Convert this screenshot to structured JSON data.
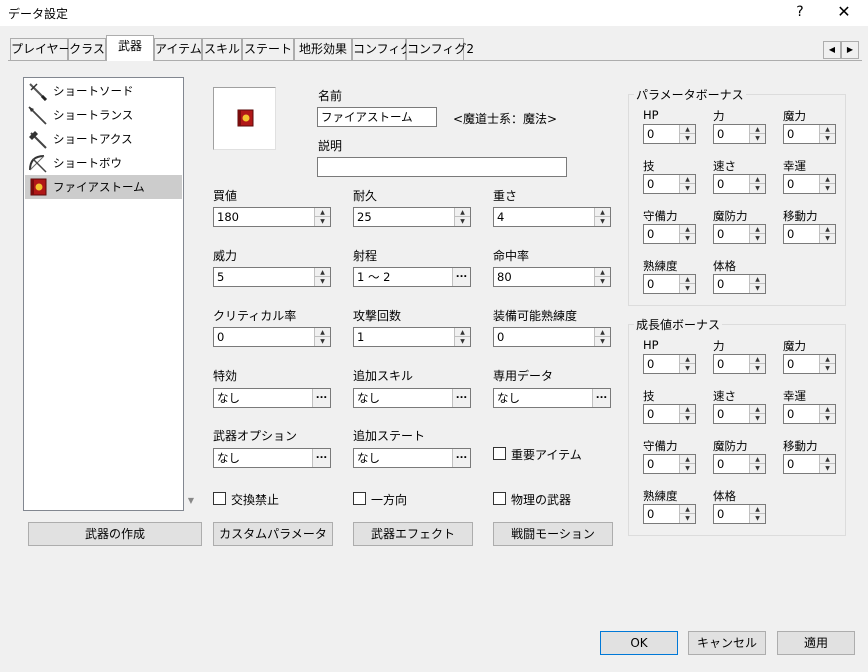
{
  "window": {
    "title": "データ設定",
    "help": "?",
    "close": "✕"
  },
  "tabs": [
    "プレイヤー",
    "クラス",
    "武器",
    "アイテム",
    "スキル",
    "ステート",
    "地形効果",
    "コンフィグ",
    "コンフィグ2"
  ],
  "weapon_list": [
    {
      "name": "ショートソード",
      "icon": "sword-icon"
    },
    {
      "name": "ショートランス",
      "icon": "lance-icon"
    },
    {
      "name": "ショートアクス",
      "icon": "axe-icon"
    },
    {
      "name": "ショートボウ",
      "icon": "bow-icon"
    },
    {
      "name": "ファイアストーム",
      "icon": "fire-tome-icon"
    }
  ],
  "detail": {
    "name_label": "名前",
    "name_value": "ファイアストーム",
    "type_text": "<魔道士系：魔法>",
    "desc_label": "説明",
    "desc_value": "",
    "price_label": "買値",
    "price_value": "180",
    "durability_label": "耐久",
    "durability_value": "25",
    "weight_label": "重さ",
    "weight_value": "4",
    "power_label": "威力",
    "power_value": "5",
    "range_label": "射程",
    "range_value": "1 ～ 2",
    "hit_label": "命中率",
    "hit_value": "80",
    "crit_label": "クリティカル率",
    "crit_value": "0",
    "attacks_label": "攻撃回数",
    "attacks_value": "1",
    "proficiency_label": "装備可能熟練度",
    "proficiency_value": "0",
    "effective_label": "特効",
    "effective_value": "なし",
    "add_skill_label": "追加スキル",
    "add_skill_value": "なし",
    "exclusive_label": "専用データ",
    "exclusive_value": "なし",
    "option_label": "武器オプション",
    "option_value": "なし",
    "add_state_label": "追加ステート",
    "add_state_value": "なし",
    "important_label": "重要アイテム",
    "no_trade_label": "交換禁止",
    "one_way_label": "一方向",
    "physical_label": "物理の武器"
  },
  "buttons": {
    "create": "武器の作成",
    "custom": "カスタムパラメータ",
    "effect": "武器エフェクト",
    "motion": "戦闘モーション",
    "ok": "OK",
    "cancel": "キャンセル",
    "apply": "適用"
  },
  "param_bonus": {
    "title": "パラメータボーナス",
    "labels": [
      "HP",
      "力",
      "魔力",
      "技",
      "速さ",
      "幸運",
      "守備力",
      "魔防力",
      "移動力",
      "熟練度",
      "体格"
    ],
    "values": [
      "0",
      "0",
      "0",
      "0",
      "0",
      "0",
      "0",
      "0",
      "0",
      "0",
      "0"
    ]
  },
  "growth_bonus": {
    "title": "成長値ボーナス",
    "labels": [
      "HP",
      "力",
      "魔力",
      "技",
      "速さ",
      "幸運",
      "守備力",
      "魔防力",
      "移動力",
      "熟練度",
      "体格"
    ],
    "values": [
      "0",
      "0",
      "0",
      "0",
      "0",
      "0",
      "0",
      "0",
      "0",
      "0",
      "0"
    ]
  }
}
